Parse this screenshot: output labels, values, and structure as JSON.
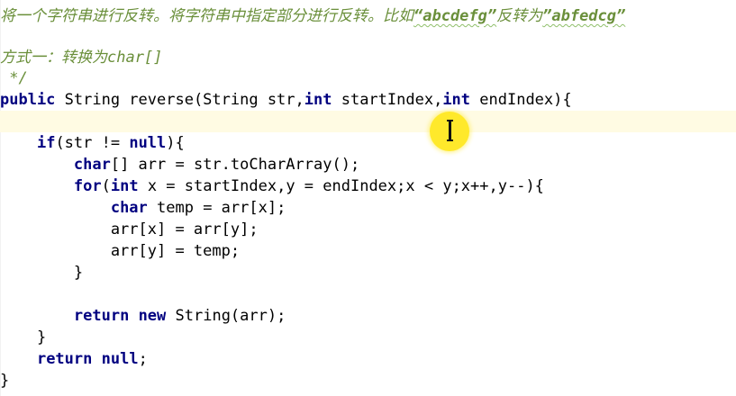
{
  "comment": {
    "line1_prefix": "将一个字符串进行反转。将字符串中指定部分进行反转。比如",
    "line1_q1": "“abcdefg”",
    "line1_mid": "反转为",
    "line1_q2": "”abfedcg”",
    "line3": "方式一：转换为char[]",
    "line4": " */"
  },
  "code": {
    "l5_kw": "public",
    "l5_rest": " String reverse(String str,",
    "l5_kw2": "int",
    "l5_rest2": " startIndex,",
    "l5_kw3": "int",
    "l5_rest3": " endIndex){",
    "l7_indent": "    ",
    "l7_kw": "if",
    "l7_rest": "(str != ",
    "l7_kw2": "null",
    "l7_rest2": "){",
    "l8_indent": "        ",
    "l8_kw": "char",
    "l8_rest": "[] arr = str.toCharArray();",
    "l9_indent": "        ",
    "l9_kw": "for",
    "l9_rest": "(",
    "l9_kw2": "int",
    "l9_rest2": " x = startIndex,y = endIndex;x < y;x++,y--){",
    "l10_indent": "            ",
    "l10_kw": "char",
    "l10_rest": " temp = arr[x];",
    "l11": "            arr[x] = arr[y];",
    "l12": "            arr[y] = temp;",
    "l13": "        }",
    "l15_indent": "        ",
    "l15_kw": "return",
    "l15_sp": " ",
    "l15_kw2": "new",
    "l15_rest": " String(arr);",
    "l16": "    }",
    "l17_indent": "    ",
    "l17_kw": "return",
    "l17_sp": " ",
    "l17_kw2": "null",
    "l17_rest": ";",
    "l18": "}"
  },
  "colors": {
    "keyword": "#000080",
    "comment": "#6a8f3a",
    "current_line": "#fffbe3",
    "cursor_highlight": "#ffe92b"
  },
  "icons": {
    "cursor": "text-cursor-icon"
  }
}
